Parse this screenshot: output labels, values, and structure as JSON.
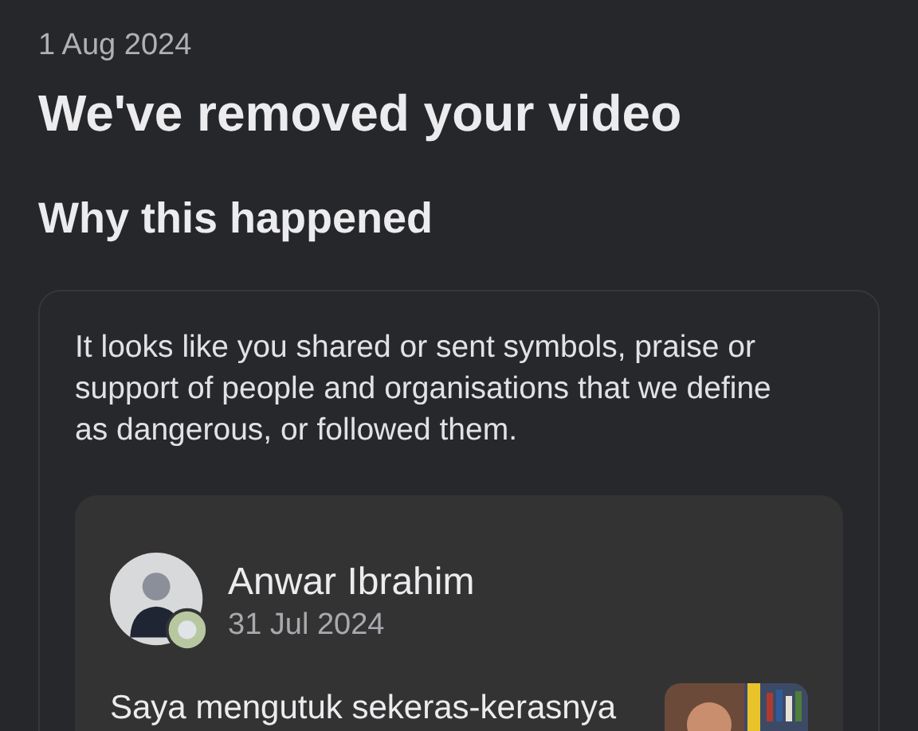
{
  "date": "1 Aug 2024",
  "title": "We've removed your video",
  "section_title": "Why this happened",
  "explanation": "It looks like you shared or sent symbols, praise or support of people and organisations that we define as dangerous, or followed them.",
  "post": {
    "author": "Anwar Ibrahim",
    "date": "31 Jul 2024",
    "text": "Saya mengutuk sekeras-kerasnya"
  }
}
